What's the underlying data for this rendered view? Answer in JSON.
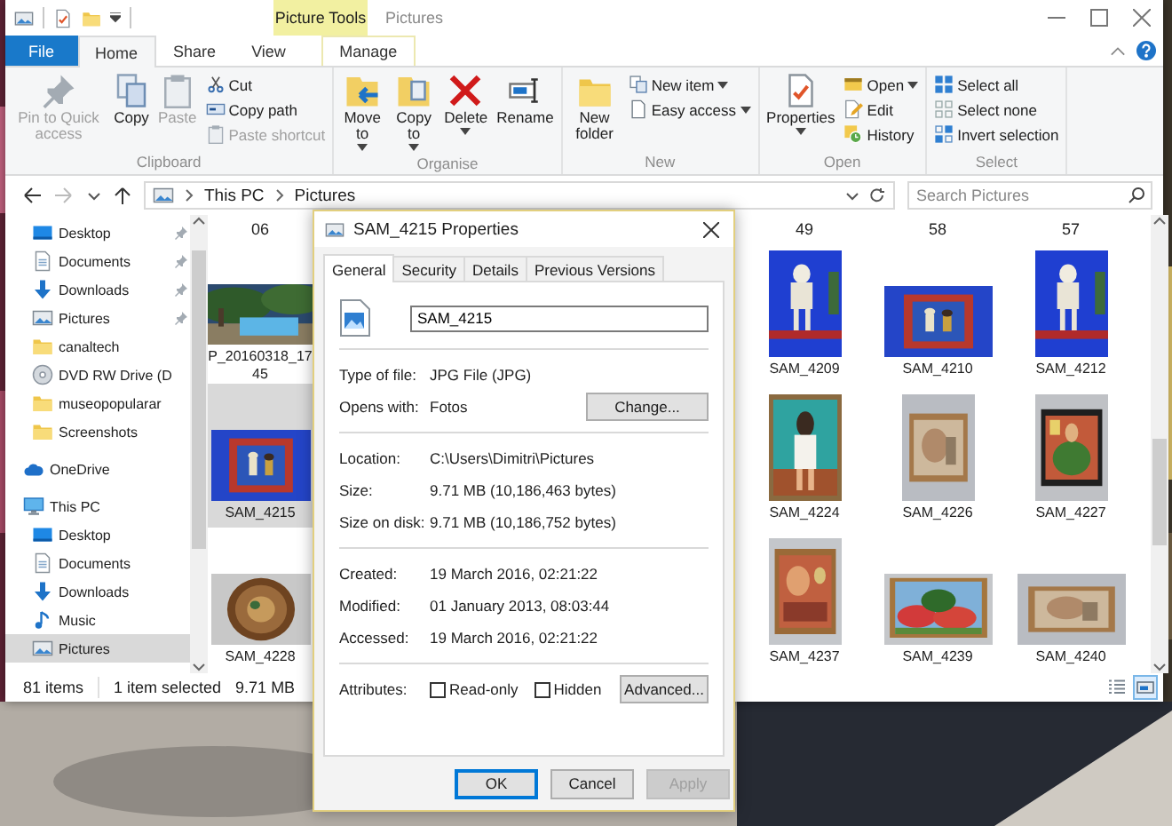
{
  "window": {
    "title": "Pictures",
    "context_group": "Picture Tools"
  },
  "tabs": [
    {
      "label": "File",
      "kind": "file",
      "selected": false
    },
    {
      "label": "Home",
      "kind": "tab",
      "selected": true
    },
    {
      "label": "Share",
      "kind": "tab",
      "selected": false
    },
    {
      "label": "View",
      "kind": "tab",
      "selected": false
    },
    {
      "label": "Manage",
      "kind": "context",
      "selected": false
    }
  ],
  "ribbon": {
    "groups": [
      {
        "label": "Clipboard",
        "large": [
          {
            "label": "Pin to Quick access",
            "kind": "pin",
            "disabled": true,
            "dropdown": false
          },
          {
            "label": "Copy",
            "kind": "copy",
            "disabled": false,
            "dropdown": false
          },
          {
            "label": "Paste",
            "kind": "paste",
            "disabled": true,
            "dropdown": false
          }
        ],
        "small": [
          {
            "label": "Cut",
            "kind": "cut",
            "disabled": false,
            "dropdown": false
          },
          {
            "label": "Copy path",
            "kind": "copy-path",
            "disabled": false,
            "dropdown": false
          },
          {
            "label": "Paste shortcut",
            "kind": "paste-shortcut",
            "disabled": true,
            "dropdown": false
          }
        ]
      },
      {
        "label": "Organise",
        "large": [
          {
            "label": "Move to",
            "kind": "move",
            "disabled": false,
            "dropdown": true
          },
          {
            "label": "Copy to",
            "kind": "copy-to",
            "disabled": false,
            "dropdown": true
          },
          {
            "label": "Delete",
            "kind": "delete",
            "disabled": false,
            "dropdown": true
          },
          {
            "label": "Rename",
            "kind": "rename",
            "disabled": false,
            "dropdown": false
          }
        ]
      },
      {
        "label": "New",
        "large": [
          {
            "label": "New folder",
            "kind": "new-folder",
            "disabled": false,
            "dropdown": false
          }
        ],
        "small": [
          {
            "label": "New item",
            "kind": "new-item",
            "disabled": false,
            "dropdown": true
          },
          {
            "label": "Easy access",
            "kind": "easy-access",
            "disabled": false,
            "dropdown": true
          }
        ]
      },
      {
        "label": "Open",
        "large": [
          {
            "label": "Properties",
            "kind": "properties",
            "disabled": false,
            "dropdown": true
          }
        ],
        "small": [
          {
            "label": "Open",
            "kind": "open",
            "disabled": false,
            "dropdown": true
          },
          {
            "label": "Edit",
            "kind": "edit",
            "disabled": false,
            "dropdown": false
          },
          {
            "label": "History",
            "kind": "history",
            "disabled": false,
            "dropdown": false
          }
        ]
      },
      {
        "label": "Select",
        "small": [
          {
            "label": "Select all",
            "kind": "select-all",
            "disabled": false,
            "dropdown": false
          },
          {
            "label": "Select none",
            "kind": "select-none",
            "disabled": false,
            "dropdown": false
          },
          {
            "label": "Invert selection",
            "kind": "invert",
            "disabled": false,
            "dropdown": false
          }
        ]
      }
    ]
  },
  "address": {
    "path": [
      "This PC",
      "Pictures"
    ]
  },
  "search": {
    "placeholder": "Search Pictures"
  },
  "navigation": {
    "quick_access": [
      {
        "label": "Desktop",
        "kind": "desktop",
        "pinned": true,
        "selected": false
      },
      {
        "label": "Documents",
        "kind": "documents",
        "pinned": true,
        "selected": false
      },
      {
        "label": "Downloads",
        "kind": "downloads",
        "pinned": true,
        "selected": false
      },
      {
        "label": "Pictures",
        "kind": "pictures",
        "pinned": true,
        "selected": false
      },
      {
        "label": "canaltech",
        "kind": "folder",
        "pinned": false,
        "selected": false
      },
      {
        "label": "DVD RW Drive (D",
        "kind": "dvd",
        "pinned": false,
        "selected": false
      },
      {
        "label": "museopopularar",
        "kind": "folder",
        "pinned": false,
        "selected": false
      },
      {
        "label": "Screenshots",
        "kind": "folder",
        "pinned": false,
        "selected": false
      }
    ],
    "tree": [
      {
        "label": "OneDrive",
        "kind": "cloud",
        "selected": false
      },
      {
        "label": "This PC",
        "kind": "pc",
        "selected": false,
        "children": [
          {
            "label": "Desktop",
            "kind": "desktop",
            "selected": false
          },
          {
            "label": "Documents",
            "kind": "documents",
            "selected": false
          },
          {
            "label": "Downloads",
            "kind": "downloads",
            "selected": false
          },
          {
            "label": "Music",
            "kind": "music",
            "selected": false
          },
          {
            "label": "Pictures",
            "kind": "pictures",
            "selected": true
          }
        ]
      }
    ]
  },
  "files": {
    "columns": [
      {
        "top_label": "06",
        "items": [
          {
            "label": "P_20160318_17 45",
            "selected": false
          },
          {
            "label": "SAM_4215",
            "selected": true
          },
          {
            "label": "SAM_4228",
            "selected": false
          }
        ]
      },
      {
        "top_label": "49",
        "items": [
          {
            "label": "SAM_4209",
            "selected": false
          },
          {
            "label": "SAM_4224",
            "selected": false
          },
          {
            "label": "SAM_4237",
            "selected": false
          }
        ]
      },
      {
        "top_label": "58",
        "items": [
          {
            "label": "SAM_4210",
            "selected": false
          },
          {
            "label": "SAM_4226",
            "selected": false
          },
          {
            "label": "SAM_4239",
            "selected": false
          }
        ]
      },
      {
        "top_label": "57",
        "items": [
          {
            "label": "SAM_4212",
            "selected": false
          },
          {
            "label": "SAM_4227",
            "selected": false
          },
          {
            "label": "SAM_4240",
            "selected": false
          }
        ]
      }
    ]
  },
  "status_bar": {
    "item_count": "81 items",
    "selection": "1 item selected",
    "size": "9.71 MB",
    "views": [
      {
        "kind": "details",
        "selected": false
      },
      {
        "kind": "large-icons",
        "selected": true
      }
    ]
  },
  "properties_dialog": {
    "title": "SAM_4215 Properties",
    "tabs": [
      {
        "label": "General",
        "selected": true
      },
      {
        "label": "Security",
        "selected": false
      },
      {
        "label": "Details",
        "selected": false
      },
      {
        "label": "Previous Versions",
        "selected": false
      }
    ],
    "file_name": "SAM_4215",
    "sections": [
      [
        {
          "label": "Type of file:",
          "value": "JPG File (JPG)"
        },
        {
          "label": "Opens with:",
          "value": "Fotos",
          "button": "Change..."
        }
      ],
      [
        {
          "label": "Location:",
          "value": "C:\\Users\\Dimitri\\Pictures"
        },
        {
          "label": "Size:",
          "value": "9.71 MB (10,186,463 bytes)"
        },
        {
          "label": "Size on disk:",
          "value": "9.71 MB (10,186,752 bytes)"
        }
      ],
      [
        {
          "label": "Created:",
          "value": "19 March 2016, 02:21:22"
        },
        {
          "label": "Modified:",
          "value": "01 January 2013, 08:03:44"
        },
        {
          "label": "Accessed:",
          "value": "19 March 2016, 02:21:22"
        }
      ]
    ],
    "attributes": {
      "label": "Attributes:",
      "options": [
        {
          "label": "Read-only",
          "checked": false
        },
        {
          "label": "Hidden",
          "checked": false
        }
      ],
      "button": "Advanced..."
    },
    "buttons": [
      {
        "label": "OK",
        "kind": "default",
        "disabled": false
      },
      {
        "label": "Cancel",
        "kind": "normal",
        "disabled": false
      },
      {
        "label": "Apply",
        "kind": "normal",
        "disabled": true
      }
    ]
  }
}
